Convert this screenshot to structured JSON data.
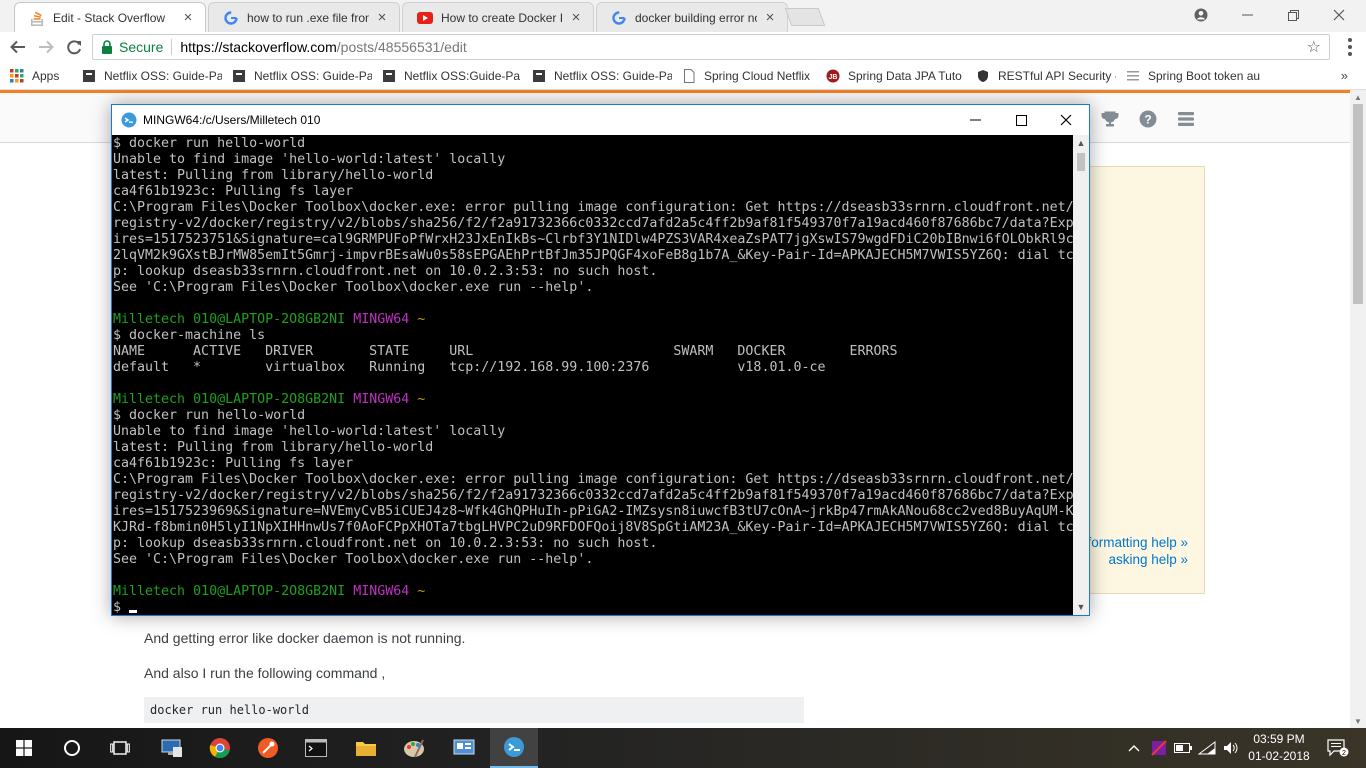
{
  "browser": {
    "tabs": [
      {
        "title": "Edit - Stack Overflow",
        "favicon": "stackoverflow-icon",
        "active": true
      },
      {
        "title": "how to run .exe file from",
        "favicon": "google-icon",
        "active": false
      },
      {
        "title": "How to create Docker Im",
        "favicon": "youtube-icon",
        "active": false
      },
      {
        "title": "docker building error no",
        "favicon": "google-icon",
        "active": false
      }
    ],
    "secure_label": "Secure",
    "url_host": "https://stackoverflow.com",
    "url_path": "/posts/48556531/edit",
    "bookmarks": [
      {
        "label": "Apps",
        "icon": "apps-grid-icon"
      },
      {
        "label": "Netflix OSS: Guide-Pa",
        "icon": "bookmark-page-icon"
      },
      {
        "label": "Netflix OSS: Guide-Pa",
        "icon": "bookmark-page-icon"
      },
      {
        "label": "Netflix OSS:Guide-Pa",
        "icon": "bookmark-page-icon"
      },
      {
        "label": "Netflix OSS: Guide-Pa",
        "icon": "bookmark-page-icon"
      },
      {
        "label": "Spring Cloud Netflix",
        "icon": "document-icon"
      },
      {
        "label": "Spring Data JPA Tuto",
        "icon": "jb-icon"
      },
      {
        "label": "RESTful API Security -",
        "icon": "shield-icon"
      },
      {
        "label": "Spring Boot token au",
        "icon": "lines-icon"
      }
    ],
    "bookmarks_more": "»"
  },
  "stackoverflow": {
    "formatting_help": "formatting help »",
    "asking_help": "asking help »",
    "para1": "And getting error like docker daemon is not running.",
    "para2": "And also I run the following command ,",
    "code": "docker run hello-world"
  },
  "terminal": {
    "title": "MINGW64:/c/Users/Milletech 010",
    "lines": [
      {
        "t": "$ docker run hello-world"
      },
      {
        "t": "Unable to find image 'hello-world:latest' locally"
      },
      {
        "t": "latest: Pulling from library/hello-world"
      },
      {
        "t": "ca4f61b1923c: Pulling fs layer"
      },
      {
        "t": "C:\\Program Files\\Docker Toolbox\\docker.exe: error pulling image configuration: Get https://dseasb33srnrn.cloudfront.net/"
      },
      {
        "t": "registry-v2/docker/registry/v2/blobs/sha256/f2/f2a91732366c0332ccd7afd2a5c4ff2b9af81f549370f7a19acd460f87686bc7/data?Exp"
      },
      {
        "t": "ires=1517523751&Signature=cal9GRMPUFoPfWrxH23JxEnIkBs~Clrbf3Y1NIDlw4PZS3VAR4xeaZsPAT7jgXswIS79wgdFDiC20bIBnwi6fOLObkRl9c"
      },
      {
        "t": "2lqVM2k9GXstBJrMW85emIt5Gmrj-impvrBEsaWu0s58sEPGAEhPrtBfJm35JPQGF4xoFeB8g1b7A_&Key-Pair-Id=APKAJECH5M7VWIS5YZ6Q: dial tc"
      },
      {
        "t": "p: lookup dseasb33srnrn.cloudfront.net on 10.0.2.3:53: no such host."
      },
      {
        "t": "See 'C:\\Program Files\\Docker Toolbox\\docker.exe run --help'."
      },
      {
        "t": ""
      },
      {
        "prompt": true,
        "user": "Milletech 010@LAPTOP-2O8GB2NI",
        "env": "MINGW64",
        "path": "~"
      },
      {
        "t": "$ docker-machine ls"
      },
      {
        "t": "NAME      ACTIVE   DRIVER       STATE     URL                         SWARM   DOCKER        ERRORS"
      },
      {
        "t": "default   *        virtualbox   Running   tcp://192.168.99.100:2376           v18.01.0-ce"
      },
      {
        "t": ""
      },
      {
        "prompt": true,
        "user": "Milletech 010@LAPTOP-2O8GB2NI",
        "env": "MINGW64",
        "path": "~"
      },
      {
        "t": "$ docker run hello-world"
      },
      {
        "t": "Unable to find image 'hello-world:latest' locally"
      },
      {
        "t": "latest: Pulling from library/hello-world"
      },
      {
        "t": "ca4f61b1923c: Pulling fs layer"
      },
      {
        "t": "C:\\Program Files\\Docker Toolbox\\docker.exe: error pulling image configuration: Get https://dseasb33srnrn.cloudfront.net/"
      },
      {
        "t": "registry-v2/docker/registry/v2/blobs/sha256/f2/f2a91732366c0332ccd7afd2a5c4ff2b9af81f549370f7a19acd460f87686bc7/data?Exp"
      },
      {
        "t": "ires=1517523969&Signature=NVEmyCvB5iCUEJ4z8~Wfk4GhQPHuIh-pPiGA2-IMZsysn8iuwcfB3tU7cOnA~jrkBp47rmAkANou68cc2ved8BuyAqUM-K"
      },
      {
        "t": "KJRd-f8bmin0H5lyI1NpXIHHnwUs7f0AoFCPpXHOTa7tbgLHVPC2uD9RFDOFQoij8V8SpGtiAM23A_&Key-Pair-Id=APKAJECH5M7VWIS5YZ6Q: dial tc"
      },
      {
        "t": "p: lookup dseasb33srnrn.cloudfront.net on 10.0.2.3:53: no such host."
      },
      {
        "t": "See 'C:\\Program Files\\Docker Toolbox\\docker.exe run --help'."
      },
      {
        "t": ""
      },
      {
        "prompt": true,
        "user": "Milletech 010@LAPTOP-2O8GB2NI",
        "env": "MINGW64",
        "path": "~"
      },
      {
        "t": "$",
        "cursor": true
      }
    ]
  },
  "taskbar": {
    "time": "03:59 PM",
    "date": "01-02-2018",
    "notifications": "2"
  },
  "colors": {
    "so_orange": "#f48024",
    "so_link": "#0077cc",
    "prompt_user": "#1ea01e",
    "prompt_env": "#c030c0",
    "secure_green": "#0b8043"
  }
}
